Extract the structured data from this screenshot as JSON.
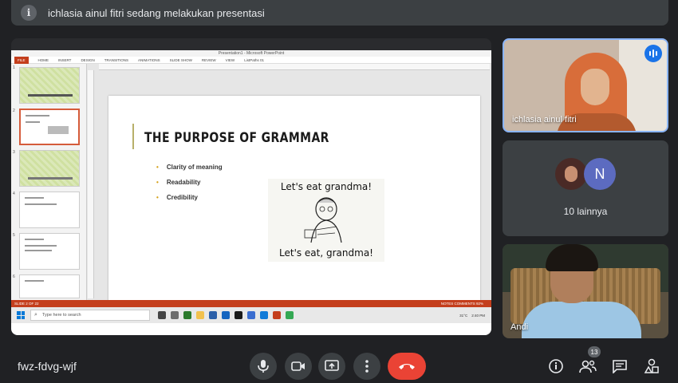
{
  "banner": {
    "message": "ichlasia ainul fitri sedang melakukan presentasi"
  },
  "powerpoint": {
    "window_title": "Presentation1 - Microsoft PowerPoint",
    "ribbon_tabs": [
      "FILE",
      "HOME",
      "INSERT",
      "DESIGN",
      "TRANSITIONS",
      "ANIMATIONS",
      "SLIDE SHOW",
      "REVIEW",
      "VIEW",
      "ListPaths 01"
    ],
    "thumb_numbers": [
      "1",
      "2",
      "3",
      "4",
      "5",
      "6"
    ],
    "slide": {
      "title": "THE PURPOSE OF GRAMMAR",
      "bullets": [
        "Clarity of meaning",
        "Readability",
        "Credibility"
      ],
      "meme_top": "Let's eat grandma!",
      "meme_bottom": "Let's eat, grandma!"
    },
    "status_left": "SLIDE 2 OF 22",
    "status_right": "NOTES  COMMENTS  92%",
    "taskbar_search": "Type here to search",
    "tray_time": "2:40 PM",
    "tray_temp": "31°C"
  },
  "participants": {
    "presenter": "ichlasia ainul fitri",
    "avatar_letter": "N",
    "others_label": "10 lainnya",
    "third": "Andi"
  },
  "bottombar": {
    "meeting_code": "fwz-fdvg-wjf",
    "people_count": "13"
  },
  "colors": {
    "end_call": "#ea4335",
    "accent": "#8ab4f8",
    "ppt_orange": "#c43e1c"
  }
}
